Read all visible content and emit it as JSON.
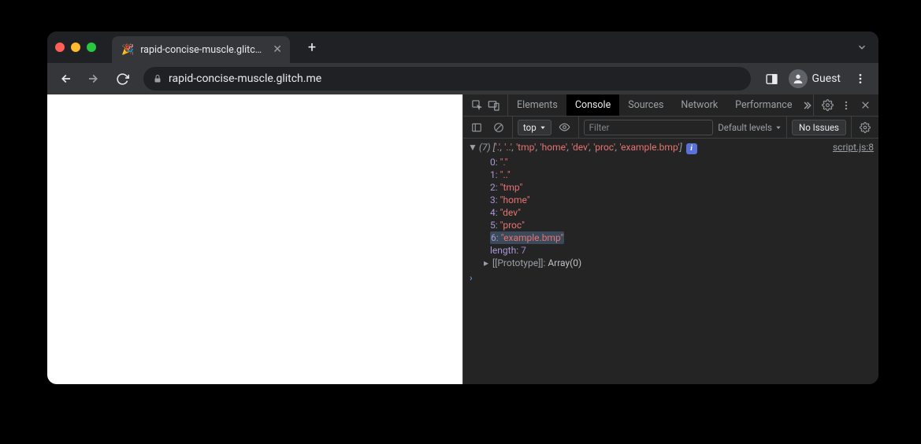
{
  "tab": {
    "title": "rapid-concise-muscle.glitch.m",
    "favicon": "🎉"
  },
  "url": "rapid-concise-muscle.glitch.me",
  "guest_label": "Guest",
  "devtools": {
    "tabs": [
      "Elements",
      "Console",
      "Sources",
      "Network",
      "Performance"
    ],
    "active_tab": "Console",
    "context": "top",
    "filter_placeholder": "Filter",
    "levels_label": "Default levels",
    "issues_label": "No Issues",
    "source_link": "script.js:8",
    "array_length_label": "(7)",
    "array_inline": [
      "'.'",
      "'..'",
      "'tmp'",
      "'home'",
      "'dev'",
      "'proc'",
      "'example.bmp'"
    ],
    "entries": [
      {
        "index": "0",
        "value": "\".\""
      },
      {
        "index": "1",
        "value": "\"..\""
      },
      {
        "index": "2",
        "value": "\"tmp\""
      },
      {
        "index": "3",
        "value": "\"home\""
      },
      {
        "index": "4",
        "value": "\"dev\""
      },
      {
        "index": "5",
        "value": "\"proc\""
      },
      {
        "index": "6",
        "value": "\"example.bmp\"",
        "highlighted": true
      }
    ],
    "length_label": "length",
    "length_value": "7",
    "prototype_label": "[[Prototype]]",
    "prototype_value": "Array(0)"
  }
}
